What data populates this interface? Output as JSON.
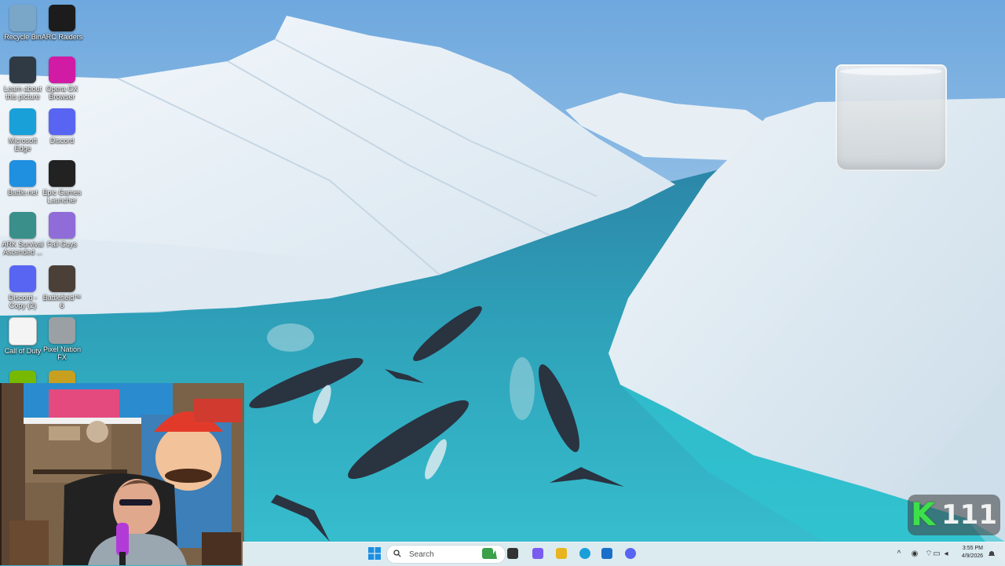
{
  "desktop_icons": [
    {
      "label": "Recycle Bin",
      "icon": "recycle-bin-icon",
      "color": "#7aa6c8"
    },
    {
      "label": "ARC Raiders",
      "icon": "arc-raiders-icon",
      "color": "#1c1c1c"
    },
    {
      "label": "Learn about this picture",
      "icon": "camera-icon",
      "color": "#2f3a44"
    },
    {
      "label": "Opera GX Browser",
      "icon": "opera-gx-icon",
      "color": "#d11ba4"
    },
    {
      "label": "Microsoft Edge",
      "icon": "edge-icon",
      "color": "#1aa0d8"
    },
    {
      "label": "Discord",
      "icon": "discord-icon",
      "color": "#5865f2"
    },
    {
      "label": "Battle.net",
      "icon": "battlenet-icon",
      "color": "#1f8fe0"
    },
    {
      "label": "Epic Games Launcher",
      "icon": "epic-games-icon",
      "color": "#222222"
    },
    {
      "label": "ARK Survival Ascended ...",
      "icon": "ark-icon",
      "color": "#3a8f8a"
    },
    {
      "label": "Fall Guys",
      "icon": "fall-guys-icon",
      "color": "#8f6cd8"
    },
    {
      "label": "Discord - Copy (2)",
      "icon": "discord-icon",
      "color": "#5865f2"
    },
    {
      "label": "Battlefield™ 6",
      "icon": "battlefield-icon",
      "color": "#4a4038"
    },
    {
      "label": "Call of Duty",
      "icon": "document-icon",
      "color": "#f4f4f4"
    },
    {
      "label": "Pixel Nation FX",
      "icon": "cube-icon",
      "color": "#9aa0a4"
    },
    {
      "label": "",
      "icon": "nvidia-icon",
      "color": "#76b900"
    },
    {
      "label": "",
      "icon": "gaming-icon",
      "color": "#c8a020"
    }
  ],
  "kill_counter": {
    "letter": "K",
    "value": "111",
    "color": "#3ee04a"
  },
  "taskbar": {
    "start_icon": "windows-start-icon",
    "search_placeholder": "Search",
    "pinned": [
      {
        "name": "widgets-icon"
      },
      {
        "name": "task-view-icon"
      },
      {
        "name": "copilot-icon"
      },
      {
        "name": "file-explorer-icon"
      },
      {
        "name": "edge-icon"
      },
      {
        "name": "microsoft-store-icon"
      },
      {
        "name": "discord-icon"
      }
    ],
    "tray": [
      {
        "name": "show-hidden-icons-chevron",
        "glyph": "^"
      },
      {
        "name": "network-icon",
        "glyph": "◉"
      },
      {
        "name": "wifi-icon",
        "glyph": "⌔"
      },
      {
        "name": "display-icon",
        "glyph": "▭"
      },
      {
        "name": "volume-icon",
        "glyph": "◂"
      }
    ],
    "time": "3:55 PM",
    "date": "4/9/2026",
    "notification_icon": "notification-bell-icon"
  }
}
